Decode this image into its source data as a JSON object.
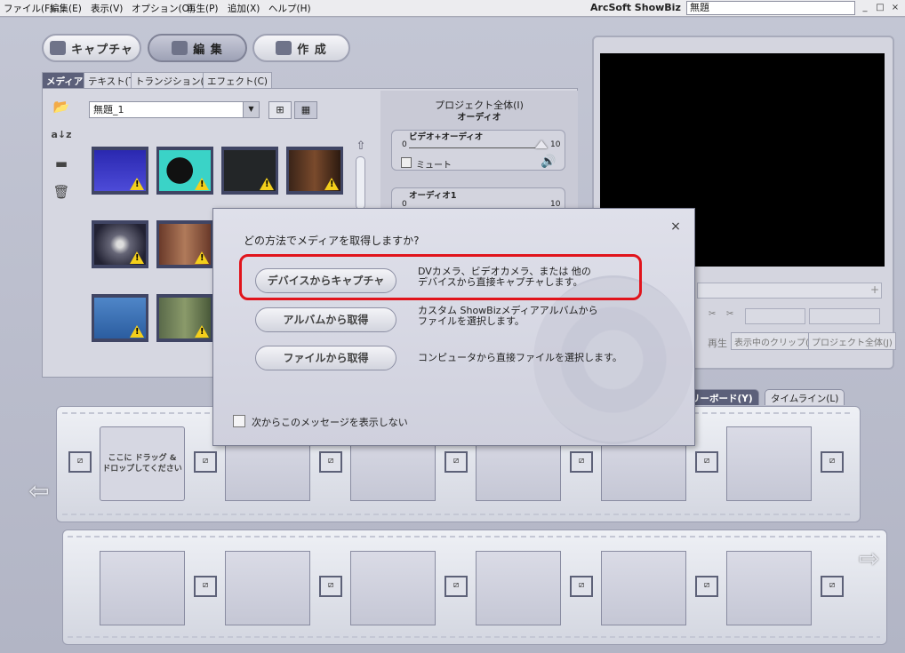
{
  "menubar": {
    "items": [
      "ファイル(F)",
      "編集(E)",
      "表示(V)",
      "オプション(O)",
      "再生(P)",
      "追加(X)",
      "ヘルプ(H)"
    ],
    "app_title": "ArcSoft ShowBiz",
    "project_name": "無題",
    "window_buttons": [
      "_",
      "□",
      "×"
    ]
  },
  "modes": {
    "capture": "キャプチャ",
    "edit": "編 集",
    "create": "作 成"
  },
  "media_tabs": [
    "メディア(M)",
    "テキスト(T)",
    "トランジション(N)",
    "エフェクト(C)"
  ],
  "media": {
    "album_select": "無題_1",
    "side_icons": [
      "folder-icon",
      "sort-az-icon",
      "slider-icon",
      "trash-icon"
    ]
  },
  "project_panel": {
    "title": "プロジェクト全体(I)",
    "subtitle": "オーディオ",
    "group1_label": "ビデオ+オーディオ",
    "group1_min": "0",
    "group1_max": "10",
    "mute_label": "ミュート",
    "group2_label": "オーディオ1",
    "group2_min": "0",
    "group2_max": "10"
  },
  "preview": {
    "play_label": "再生",
    "clip_button": "表示中のクリップ(A)",
    "project_button": "プロジェクト全体(J)",
    "plus": "+"
  },
  "storyboard": {
    "tab_storyboard": "ストーリーボード(Y)",
    "tab_storyboard_visible": "リーボード(Y)",
    "tab_timeline": "タイムライン(L)",
    "drop_hint_line1": "ここに ドラッグ &",
    "drop_hint_line2": "ドロップしてください"
  },
  "dialog": {
    "question": "どの方法でメディアを取得しますか?",
    "close": "×",
    "buttons": [
      {
        "label": "デバイスからキャプチャ",
        "desc1": "DVカメラ、ビデオカメラ、または 他の",
        "desc2": "デバイスから直接キャプチャします。"
      },
      {
        "label": "アルバムから取得",
        "desc1": "カスタム ShowBizメディアアルバムから",
        "desc2": "ファイルを選択します。"
      },
      {
        "label": "ファイルから取得",
        "desc1": "コンピュータから直接ファイルを選択します。",
        "desc2": ""
      }
    ],
    "checkbox_label": "次からこのメッセージを表示しない"
  },
  "colors": {
    "highlight": "#e1141c",
    "panel_dark": "#404564",
    "warning": "#f4cf1b"
  }
}
